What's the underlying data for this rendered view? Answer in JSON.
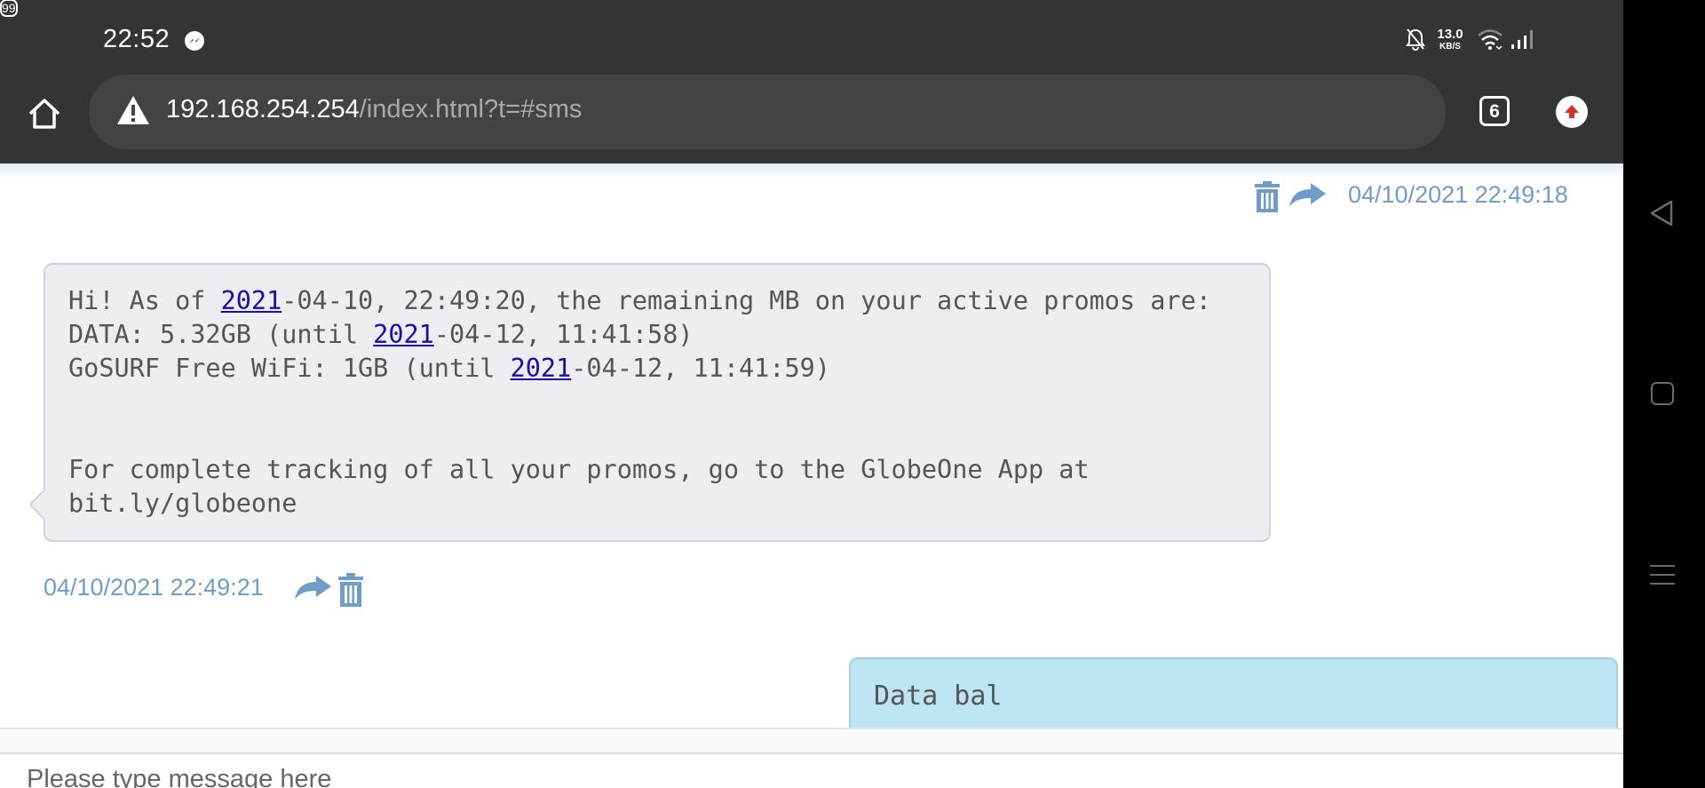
{
  "status_bar": {
    "time": "22:52",
    "net_speed_value": "13.0",
    "net_speed_unit": "KB/S",
    "battery": "99",
    "icons": [
      "messenger-icon",
      "mute-bell-icon",
      "wifi-icon",
      "signal-icon",
      "battery-icon"
    ]
  },
  "browser": {
    "url_host": "192.168.254.254",
    "url_path": "/index.html?t=#sms",
    "tab_count": "6",
    "icons": [
      "home-icon",
      "warning-icon",
      "upload-icon"
    ]
  },
  "messages": [
    {
      "direction": "outgoing-previous",
      "timestamp": "04/10/2021 22:49:18"
    },
    {
      "direction": "incoming",
      "lines": [
        {
          "pre": "Hi! As of ",
          "link": "2021",
          "post": "-04-10, 22:49:20, the remaining MB on your active promos are:"
        },
        {
          "pre": "DATA: 5.32GB (until ",
          "link": "2021",
          "post": "-04-12, 11:41:58)"
        },
        {
          "pre": "GoSURF Free WiFi: 1GB (until ",
          "link": "2021",
          "post": "-04-12, 11:41:59)"
        },
        {
          "pre": "",
          "link": "",
          "post": ""
        },
        {
          "pre": "",
          "link": "",
          "post": ""
        },
        {
          "pre": "For complete tracking of all your promos, go to the GlobeOne App at",
          "link": "",
          "post": ""
        },
        {
          "pre": "bit.ly/globeone",
          "link": "",
          "post": ""
        }
      ],
      "timestamp": "04/10/2021 22:49:21"
    },
    {
      "direction": "outgoing",
      "text": "Data bal"
    }
  ],
  "compose": {
    "placeholder": "Please type message here"
  },
  "colors": {
    "chrome_bg": "#333436",
    "url_box": "#424345",
    "timestamp": "#6f9dc9",
    "incoming_bubble": "#eeeef2",
    "outgoing_bubble": "#bde4f3",
    "link": "#1a0dab",
    "upload_red": "#d93025"
  }
}
